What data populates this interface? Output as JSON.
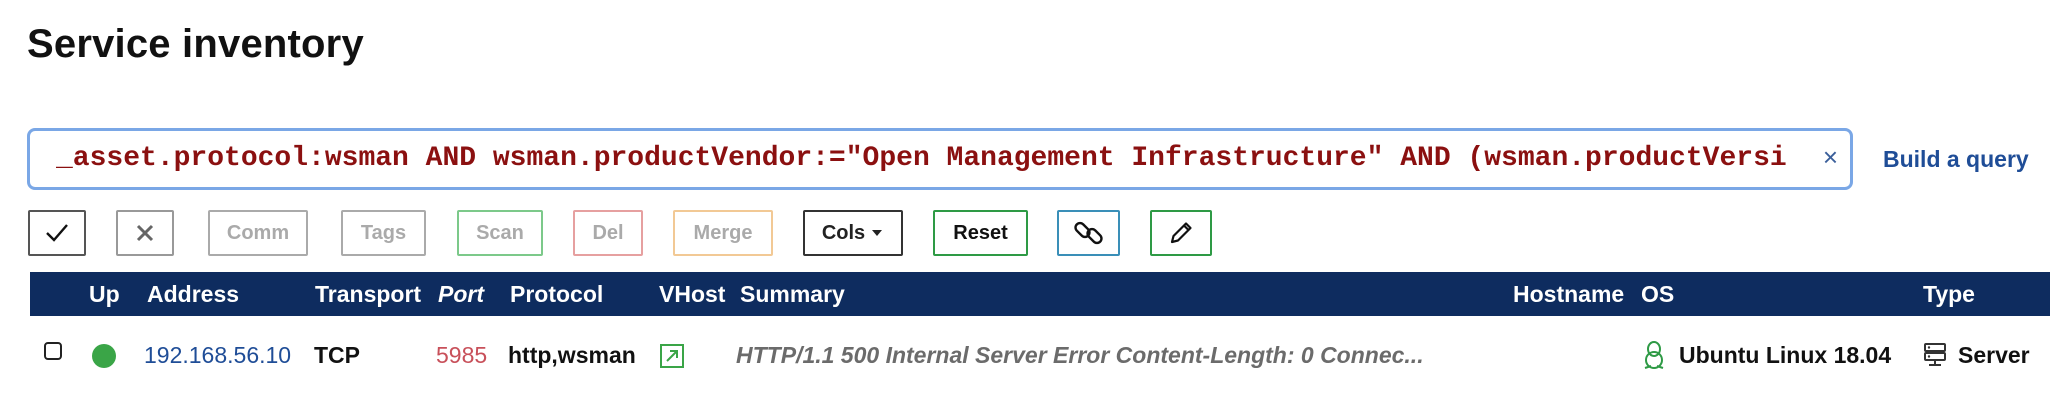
{
  "page": {
    "title": "Service inventory"
  },
  "search": {
    "query": "_asset.protocol:wsman AND wsman.productVendor:=\"Open Management Infrastructure\" AND (wsman.productVersi",
    "clear_icon": "×",
    "build_query_label": "Build a query"
  },
  "toolbar": {
    "check_icon": "check-icon",
    "cross_icon": "close-icon",
    "comm_label": "Comm",
    "tags_label": "Tags",
    "scan_label": "Scan",
    "del_label": "Del",
    "merge_label": "Merge",
    "cols_label": "Cols",
    "reset_label": "Reset",
    "link_icon": "link-icon",
    "edit_icon": "pencil-icon",
    "colors": {
      "comm": "#aaaaaa",
      "tags": "#aaaaaa",
      "scan": "#58b86a",
      "del": "#e6a0a0",
      "merge": "#f2c995",
      "cols": "#222222",
      "reset": "#2e9a45",
      "link": "#3a8fb8",
      "edit": "#2e9a45"
    }
  },
  "table": {
    "columns": {
      "up": "Up",
      "address": "Address",
      "transport": "Transport",
      "port": "Port",
      "protocol": "Protocol",
      "vhost": "VHost",
      "summary": "Summary",
      "hostname": "Hostname",
      "os": "OS",
      "type": "Type"
    },
    "rows": [
      {
        "status": "up",
        "status_color": "#3aa547",
        "address": "192.168.56.10",
        "transport": "TCP",
        "port": "5985",
        "protocol": "http,wsman",
        "vhost_icon": "external-link-icon",
        "summary": "HTTP/1.1 500 Internal Server Error Content-Length: 0 Connec...",
        "hostname": "",
        "os_icon": "linux-penguin-icon",
        "os": "Ubuntu Linux 18.04",
        "type_icon": "server-icon",
        "type": "Server"
      }
    ]
  }
}
